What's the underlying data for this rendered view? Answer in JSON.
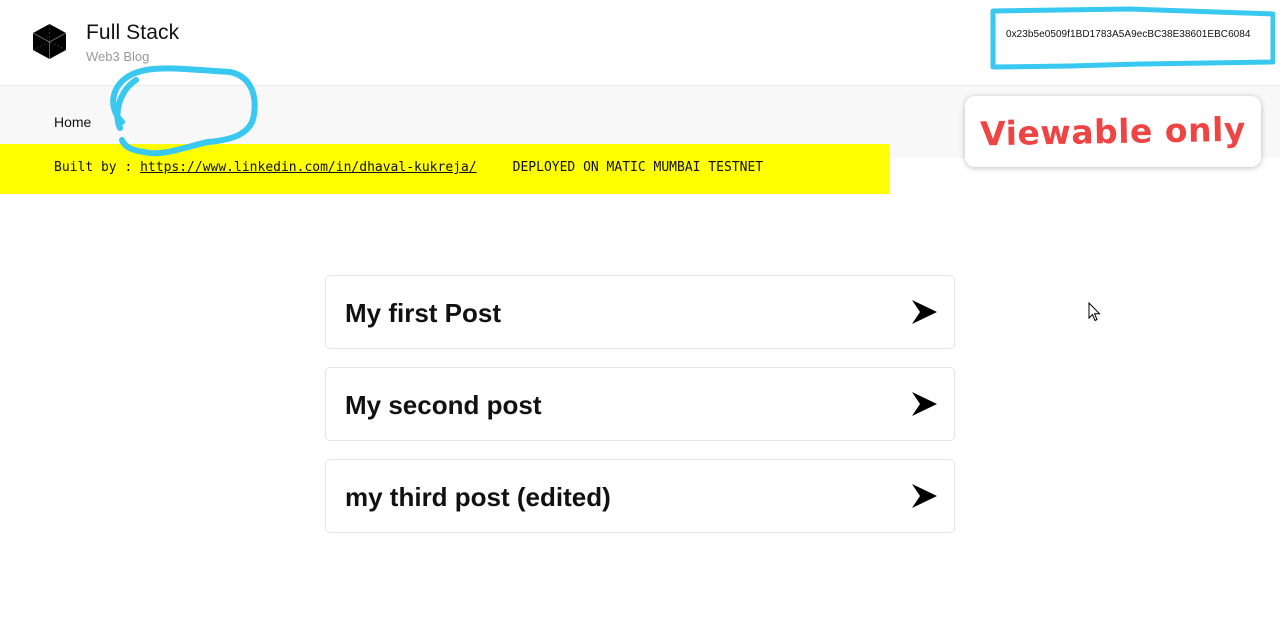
{
  "header": {
    "brand_title": "Full Stack",
    "brand_subtitle": "Web3 Blog",
    "wallet_address": "0x23b5e0509f1BD1783A5A9ecBC38E38601EBC6084"
  },
  "nav": {
    "home_label": "Home"
  },
  "banner": {
    "built_by_prefix": "Built by : ",
    "link_text": "https://www.linkedin.com/in/dhaval-kukreja/",
    "deployed_text": "DEPLOYED ON MATIC MUMBAI TESTNET"
  },
  "note": {
    "text": "Viewable only"
  },
  "posts": [
    {
      "title": "My first Post"
    },
    {
      "title": "My second post"
    },
    {
      "title": "my third post (edited)"
    }
  ],
  "colors": {
    "banner": "#ffff00",
    "annotation_outline": "#38c8f0",
    "note_text": "#ef4444"
  },
  "icons": {
    "logo": "cube-icon",
    "post_arrow": "chevron-right-icon",
    "cursor": "mouse-cursor-icon"
  }
}
